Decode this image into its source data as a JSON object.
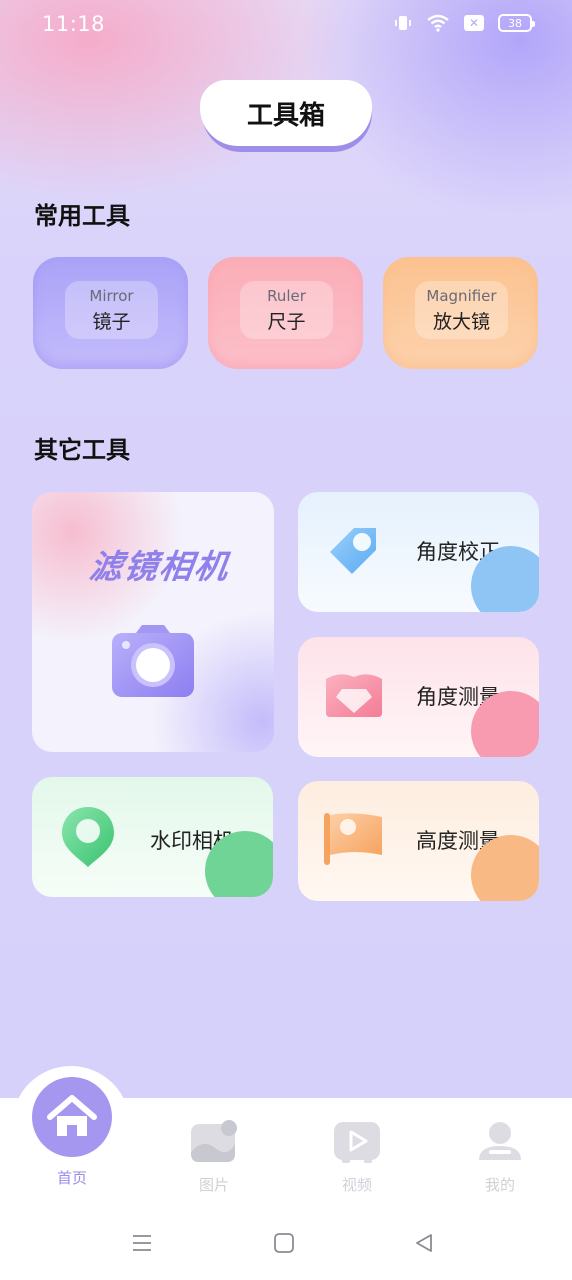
{
  "status_bar": {
    "time": "11:18",
    "battery": "38",
    "icons": [
      "vibrate-icon",
      "wifi-icon",
      "sim-off-icon",
      "battery-icon"
    ]
  },
  "header": {
    "title": "工具箱"
  },
  "common_tools": {
    "title": "常用工具",
    "items": [
      {
        "en": "Mirror",
        "zh": "镜子",
        "color": "#aaa2f7"
      },
      {
        "en": "Ruler",
        "zh": "尺子",
        "color": "#fbadb7"
      },
      {
        "en": "Magnifier",
        "zh": "放大镜",
        "color": "#fcc28f"
      }
    ]
  },
  "other_tools": {
    "title": "其它工具",
    "filter_camera": "滤镜相机",
    "angle_correction": "角度校正",
    "angle_measure": "角度测量",
    "watermark_camera": "水印相机",
    "height_measure": "高度测量"
  },
  "bottom_nav": {
    "items": [
      {
        "label": "首页",
        "icon": "home-icon",
        "active": true
      },
      {
        "label": "图片",
        "icon": "picture-icon",
        "active": false
      },
      {
        "label": "视频",
        "icon": "video-icon",
        "active": false
      },
      {
        "label": "我的",
        "icon": "profile-icon",
        "active": false
      }
    ]
  },
  "system_nav": [
    "menu-icon",
    "home-square-icon",
    "back-triangle-icon"
  ],
  "colors": {
    "accent": "#a597f0",
    "background": "#d8d2fb"
  }
}
